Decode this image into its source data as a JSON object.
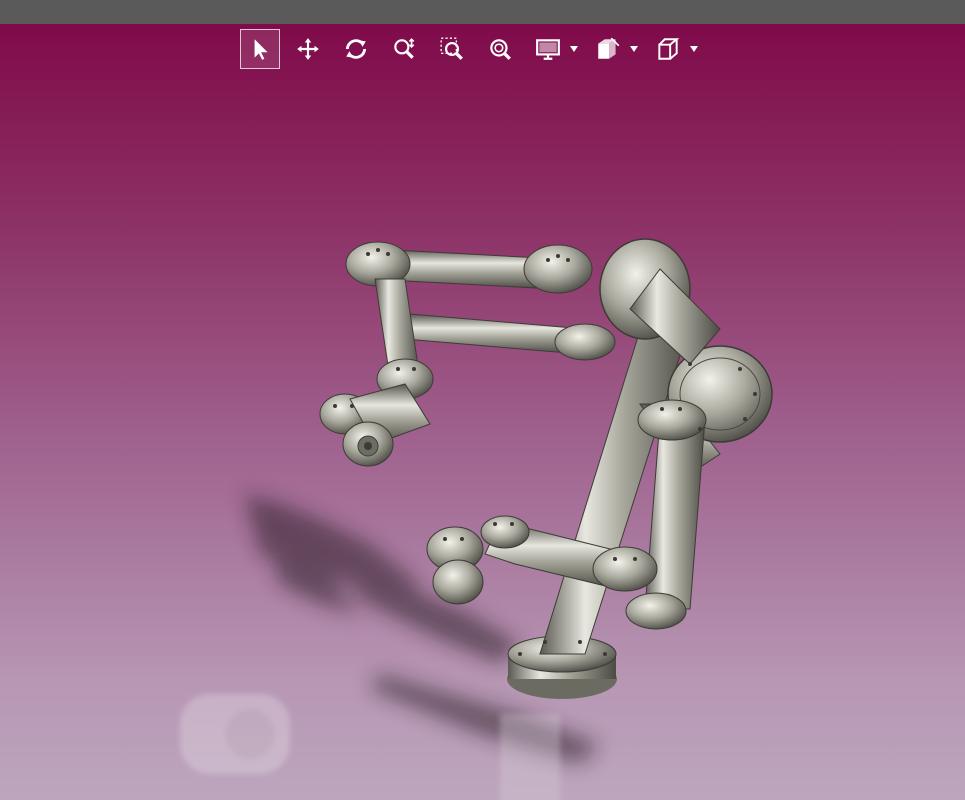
{
  "app": {
    "colors": {
      "topbar": "#5a5a5a",
      "viewport_top": "#800a4a",
      "viewport_bottom": "#bda6bd",
      "toolbar_icon": "#ffffff"
    }
  },
  "toolbar": {
    "buttons": [
      {
        "id": "select",
        "icon": "cursor-arrow-icon",
        "active": true
      },
      {
        "id": "pan",
        "icon": "move-arrows-icon",
        "active": false
      },
      {
        "id": "rotate",
        "icon": "rotate-icon",
        "active": false
      },
      {
        "id": "zoom-dynamic",
        "icon": "zoom-updown-icon",
        "active": false
      },
      {
        "id": "zoom-window",
        "icon": "zoom-window-icon",
        "active": false
      },
      {
        "id": "zoom-fit",
        "icon": "zoom-fit-icon",
        "active": false
      },
      {
        "id": "display-style",
        "icon": "monitor-icon",
        "dropdown": true
      },
      {
        "id": "section-view",
        "icon": "section-view-icon",
        "dropdown": true
      },
      {
        "id": "view-orientation",
        "icon": "cube-icon",
        "dropdown": true
      }
    ]
  },
  "scene": {
    "model": "robot-arm-assembly",
    "material_color": "#b9b9ad",
    "shadow": true,
    "reflection": true
  }
}
